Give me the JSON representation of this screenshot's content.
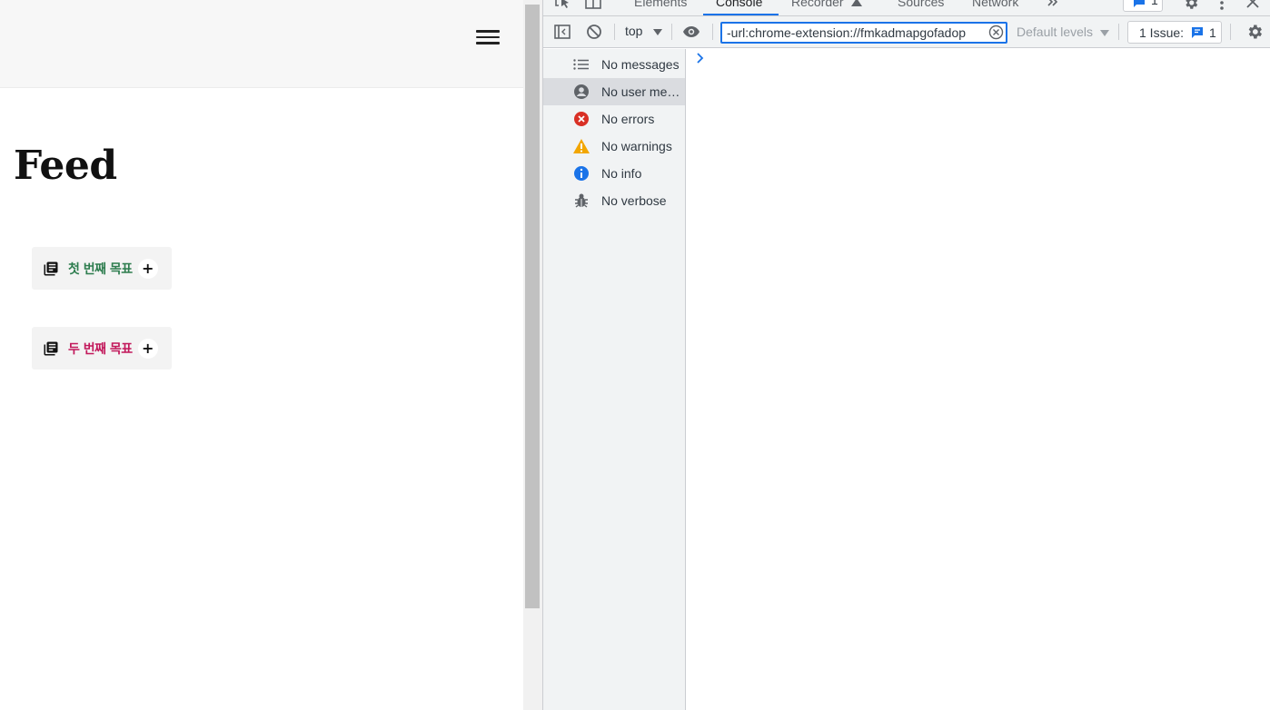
{
  "app": {
    "title": "Feed",
    "goals": [
      {
        "label": "첫 번째 목표",
        "color": "#2e7d4f",
        "plus": "+"
      },
      {
        "label": "두 번째 목표",
        "color": "#c2185b",
        "plus": "+"
      }
    ]
  },
  "devtools": {
    "tabs": [
      "Elements",
      "Console",
      "Recorder",
      "Sources",
      "Network"
    ],
    "active_tab": "Console",
    "issues_top_count": "1",
    "context": "top",
    "filter_value": "-url:chrome-extension://fmkadmapgofadop",
    "levels": "Default levels",
    "issues_label": "1 Issue:",
    "issues_count": "1",
    "sidebar": [
      {
        "label": "No messages",
        "icon": "list-icon"
      },
      {
        "label": "No user me…",
        "icon": "user-icon",
        "selected": true
      },
      {
        "label": "No errors",
        "icon": "error-icon",
        "color": "#d93025"
      },
      {
        "label": "No warnings",
        "icon": "warning-icon",
        "color": "#f2a600"
      },
      {
        "label": "No info",
        "icon": "info-icon",
        "color": "#1a73e8"
      },
      {
        "label": "No verbose",
        "icon": "bug-icon"
      }
    ]
  },
  "colors": {
    "accent": "#1a73e8"
  }
}
